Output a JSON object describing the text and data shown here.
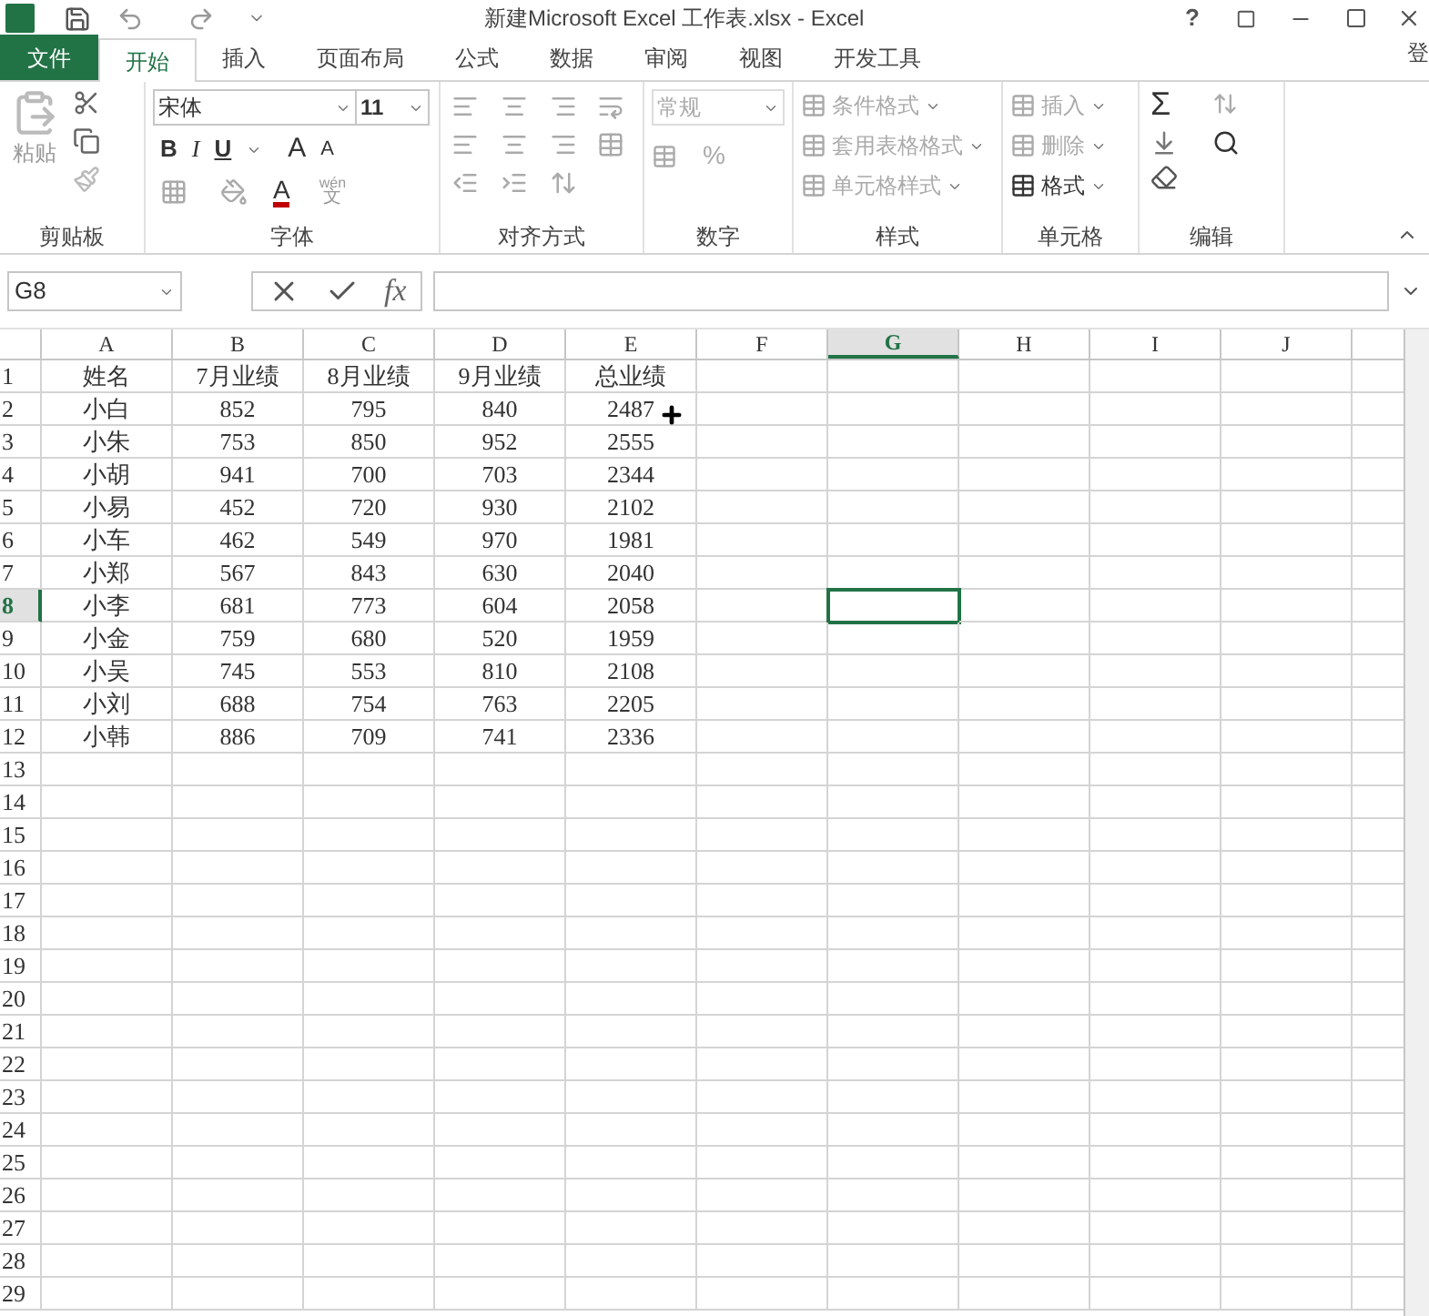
{
  "window": {
    "title": "新建Microsoft Excel 工作表.xlsx - Excel",
    "help": "?",
    "sign_in": "登"
  },
  "tabs": [
    {
      "label": "文件",
      "kind": "file",
      "selected": false
    },
    {
      "label": "开始",
      "kind": "tab",
      "selected": true
    },
    {
      "label": "插入",
      "kind": "tab",
      "selected": false
    },
    {
      "label": "页面布局",
      "kind": "tab",
      "selected": false
    },
    {
      "label": "公式",
      "kind": "tab",
      "selected": false
    },
    {
      "label": "数据",
      "kind": "tab",
      "selected": false
    },
    {
      "label": "审阅",
      "kind": "tab",
      "selected": false
    },
    {
      "label": "视图",
      "kind": "tab",
      "selected": false
    },
    {
      "label": "开发工具",
      "kind": "tab",
      "selected": false
    }
  ],
  "ribbon": {
    "paste": "粘贴",
    "font_name": "宋体",
    "font_size": "11",
    "bold": "B",
    "italic": "I",
    "underline": "U",
    "grow": "A",
    "shrink": "A",
    "font_color": "A",
    "phonetic_top": "wén",
    "phonetic_bottom": "文",
    "number_format": "常规",
    "percent": "%",
    "styles": [
      "条件格式",
      "套用表格格式",
      "单元格样式"
    ],
    "cells": [
      "插入",
      "删除",
      "格式"
    ],
    "sum": "Σ",
    "groups": [
      "剪贴板",
      "字体",
      "对齐方式",
      "数字",
      "样式",
      "单元格",
      "编辑"
    ]
  },
  "formula_bar": {
    "name_box": "G8",
    "fx": "fx"
  },
  "sheet": {
    "columns": [
      {
        "label": "A",
        "selected": false
      },
      {
        "label": "B",
        "selected": false
      },
      {
        "label": "C",
        "selected": false
      },
      {
        "label": "D",
        "selected": false
      },
      {
        "label": "E",
        "selected": false
      },
      {
        "label": "F",
        "selected": false
      },
      {
        "label": "G",
        "selected": true
      },
      {
        "label": "H",
        "selected": false
      },
      {
        "label": "I",
        "selected": false
      },
      {
        "label": "J",
        "selected": false
      }
    ],
    "row_headers": [
      {
        "label": "1",
        "selected": false
      },
      {
        "label": "2",
        "selected": false
      },
      {
        "label": "3",
        "selected": false
      },
      {
        "label": "4",
        "selected": false
      },
      {
        "label": "5",
        "selected": false
      },
      {
        "label": "6",
        "selected": false
      },
      {
        "label": "7",
        "selected": false
      },
      {
        "label": "8",
        "selected": true
      },
      {
        "label": "9",
        "selected": false
      },
      {
        "label": "10",
        "selected": false
      },
      {
        "label": "11",
        "selected": false
      },
      {
        "label": "12",
        "selected": false
      },
      {
        "label": "13",
        "selected": false
      },
      {
        "label": "14",
        "selected": false
      },
      {
        "label": "15",
        "selected": false
      },
      {
        "label": "16",
        "selected": false
      },
      {
        "label": "17",
        "selected": false
      },
      {
        "label": "18",
        "selected": false
      },
      {
        "label": "19",
        "selected": false
      },
      {
        "label": "20",
        "selected": false
      },
      {
        "label": "21",
        "selected": false
      },
      {
        "label": "22",
        "selected": false
      },
      {
        "label": "23",
        "selected": false
      },
      {
        "label": "24",
        "selected": false
      },
      {
        "label": "25",
        "selected": false
      },
      {
        "label": "26",
        "selected": false
      },
      {
        "label": "27",
        "selected": false
      },
      {
        "label": "28",
        "selected": false
      },
      {
        "label": "29",
        "selected": false
      }
    ],
    "rows": [
      [
        "姓名",
        "7月业绩",
        "8月业绩",
        "9月业绩",
        "总业绩"
      ],
      [
        "小白",
        "852",
        "795",
        "840",
        "2487"
      ],
      [
        "小朱",
        "753",
        "850",
        "952",
        "2555"
      ],
      [
        "小胡",
        "941",
        "700",
        "703",
        "2344"
      ],
      [
        "小易",
        "452",
        "720",
        "930",
        "2102"
      ],
      [
        "小车",
        "462",
        "549",
        "970",
        "1981"
      ],
      [
        "小郑",
        "567",
        "843",
        "630",
        "2040"
      ],
      [
        "小李",
        "681",
        "773",
        "604",
        "2058"
      ],
      [
        "小金",
        "759",
        "680",
        "520",
        "1959"
      ],
      [
        "小吴",
        "745",
        "553",
        "810",
        "2108"
      ],
      [
        "小刘",
        "688",
        "754",
        "763",
        "2205"
      ],
      [
        "小韩",
        "886",
        "709",
        "741",
        "2336"
      ]
    ]
  }
}
